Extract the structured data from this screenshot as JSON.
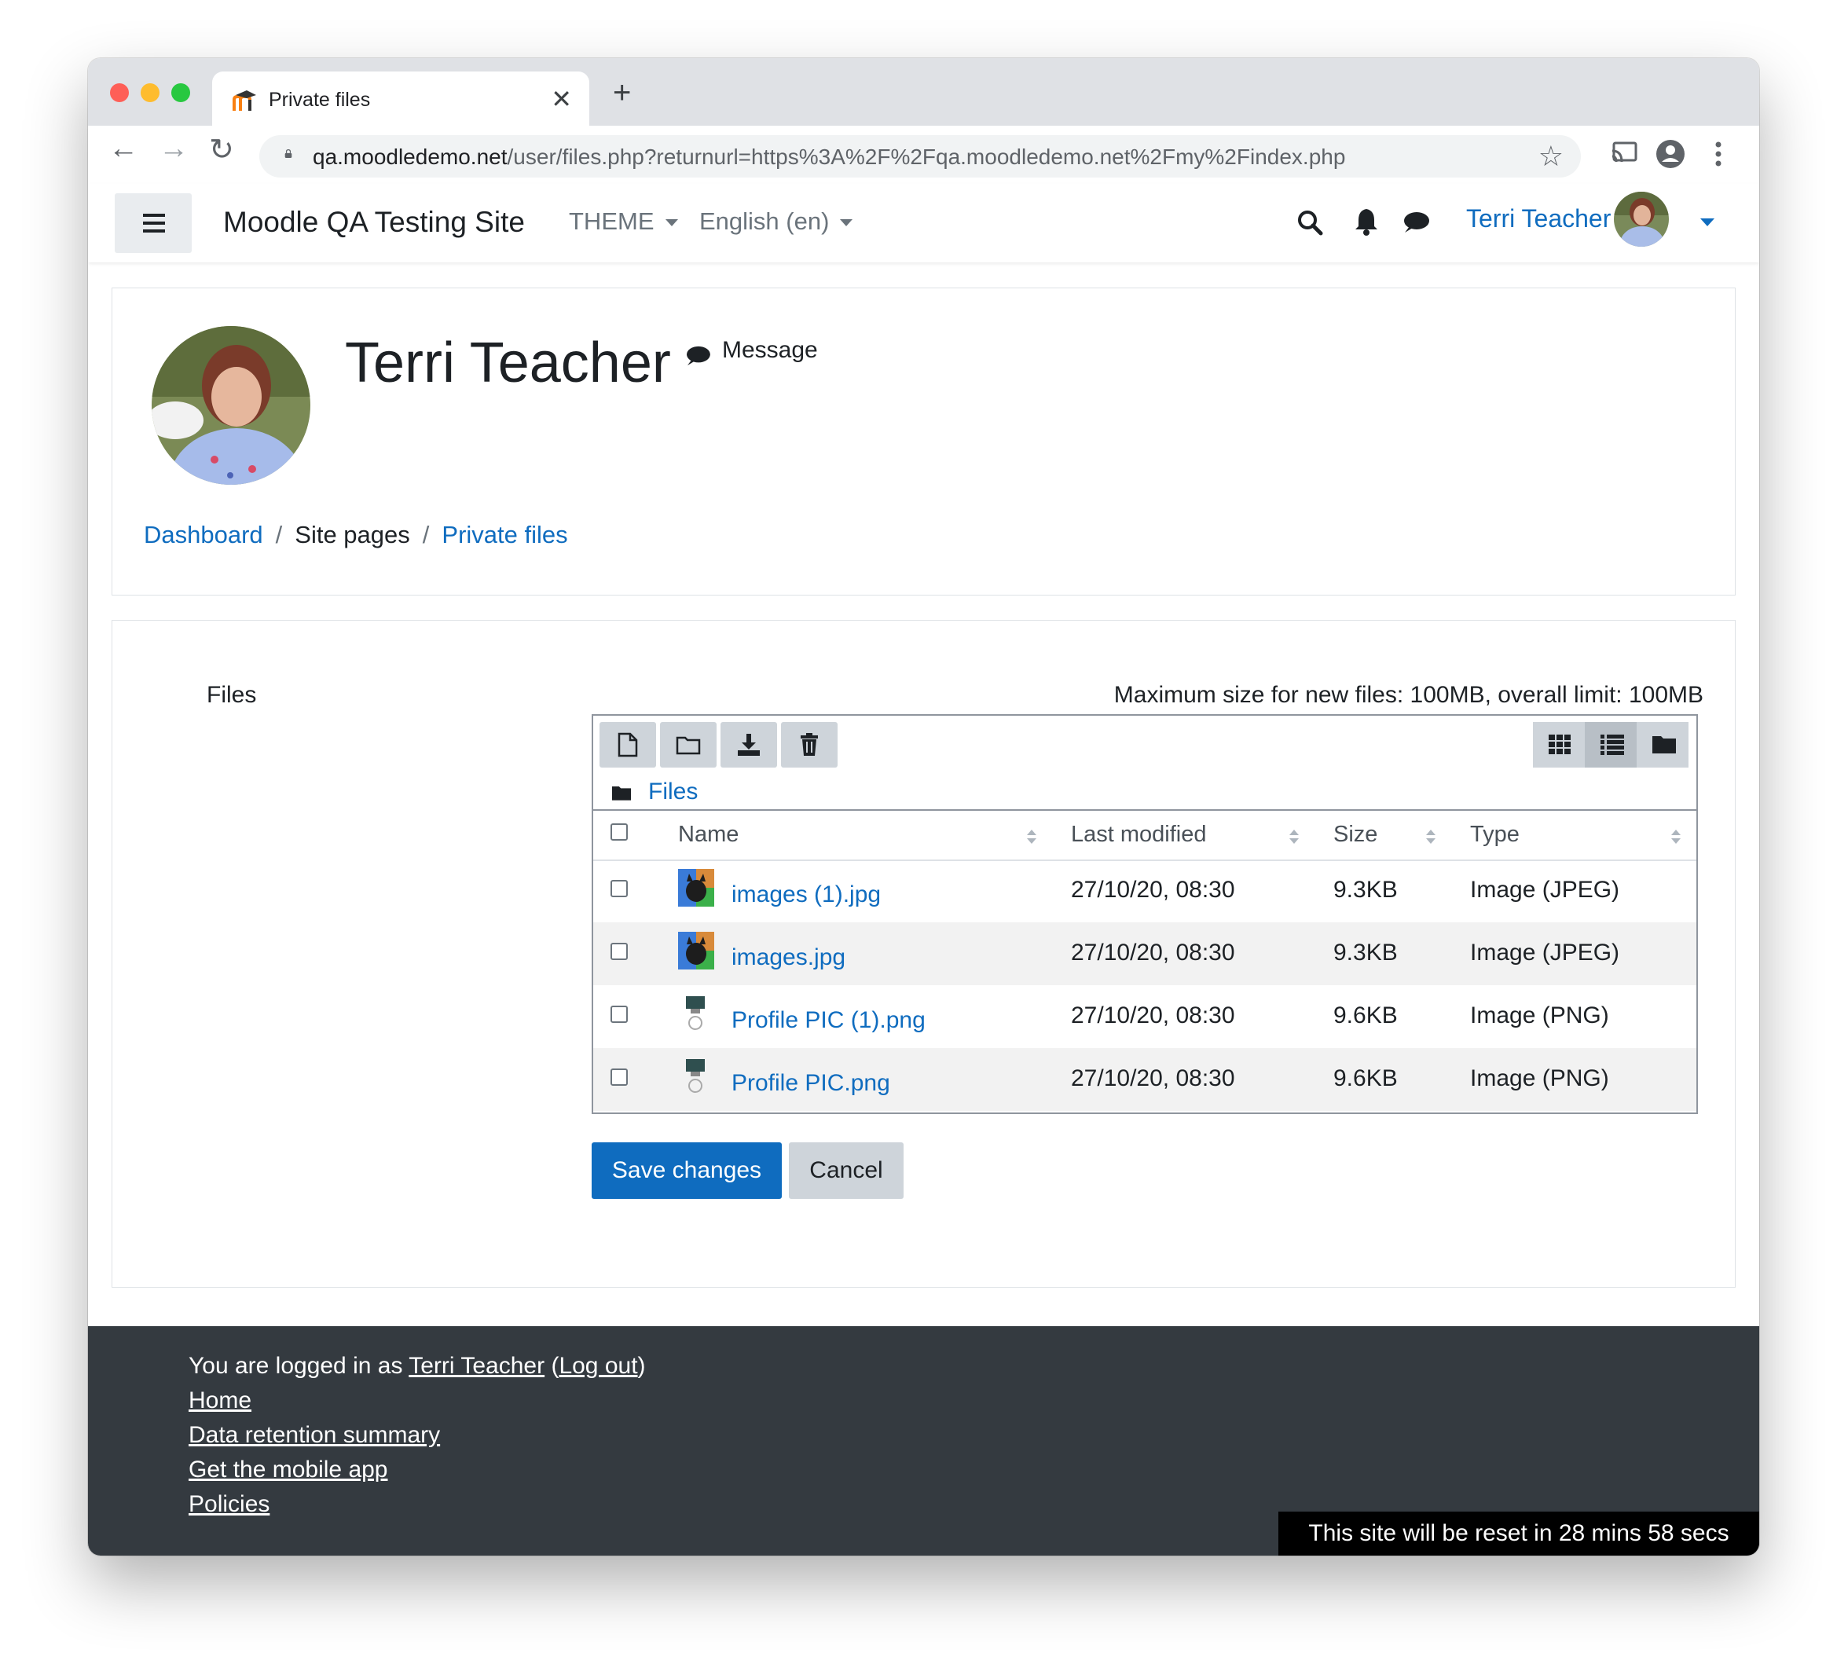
{
  "browser": {
    "tab_title": "Private files",
    "url_host": "qa.moodledemo.net",
    "url_path": "/user/files.php?returnurl=https%3A%2F%2Fqa.moodledemo.net%2Fmy%2Findex.php"
  },
  "header": {
    "site_name": "Moodle QA Testing Site",
    "theme_menu": "THEME",
    "language_menu": "English (en)",
    "user_name": "Terri Teacher"
  },
  "profile": {
    "name": "Terri Teacher",
    "message_label": "Message"
  },
  "breadcrumb": [
    {
      "label": "Dashboard"
    },
    {
      "label": "Site pages"
    },
    {
      "label": "Private files"
    }
  ],
  "files": {
    "label": "Files",
    "max_size": "Maximum size for new files: 100MB, overall limit: 100MB",
    "path_label": "Files",
    "columns": [
      "Name",
      "Last modified",
      "Size",
      "Type"
    ],
    "rows": [
      {
        "name": "images (1).jpg",
        "modified": "27/10/20, 08:30",
        "size": "9.3KB",
        "type": "Image (JPEG)"
      },
      {
        "name": "images.jpg",
        "modified": "27/10/20, 08:30",
        "size": "9.3KB",
        "type": "Image (JPEG)"
      },
      {
        "name": "Profile PIC (1).png",
        "modified": "27/10/20, 08:30",
        "size": "9.6KB",
        "type": "Image (PNG)"
      },
      {
        "name": "Profile PIC.png",
        "modified": "27/10/20, 08:30",
        "size": "9.6KB",
        "type": "Image (PNG)"
      }
    ]
  },
  "form": {
    "save_label": "Save changes",
    "cancel_label": "Cancel"
  },
  "footer": {
    "logged_in_prefix": "You are logged in as",
    "logged_in_user": "Terri Teacher",
    "logout_open": " (",
    "logout_label": "Log out",
    "logout_close": ")",
    "links": [
      "Home",
      "Data retention summary",
      "Get the mobile app",
      "Policies"
    ],
    "reset_notice": "This site will be reset in 28 mins 58 secs"
  },
  "colors": {
    "link": "#0f6cbf",
    "primary_button": "#0f6cbf",
    "footer_bg": "#343a40"
  }
}
